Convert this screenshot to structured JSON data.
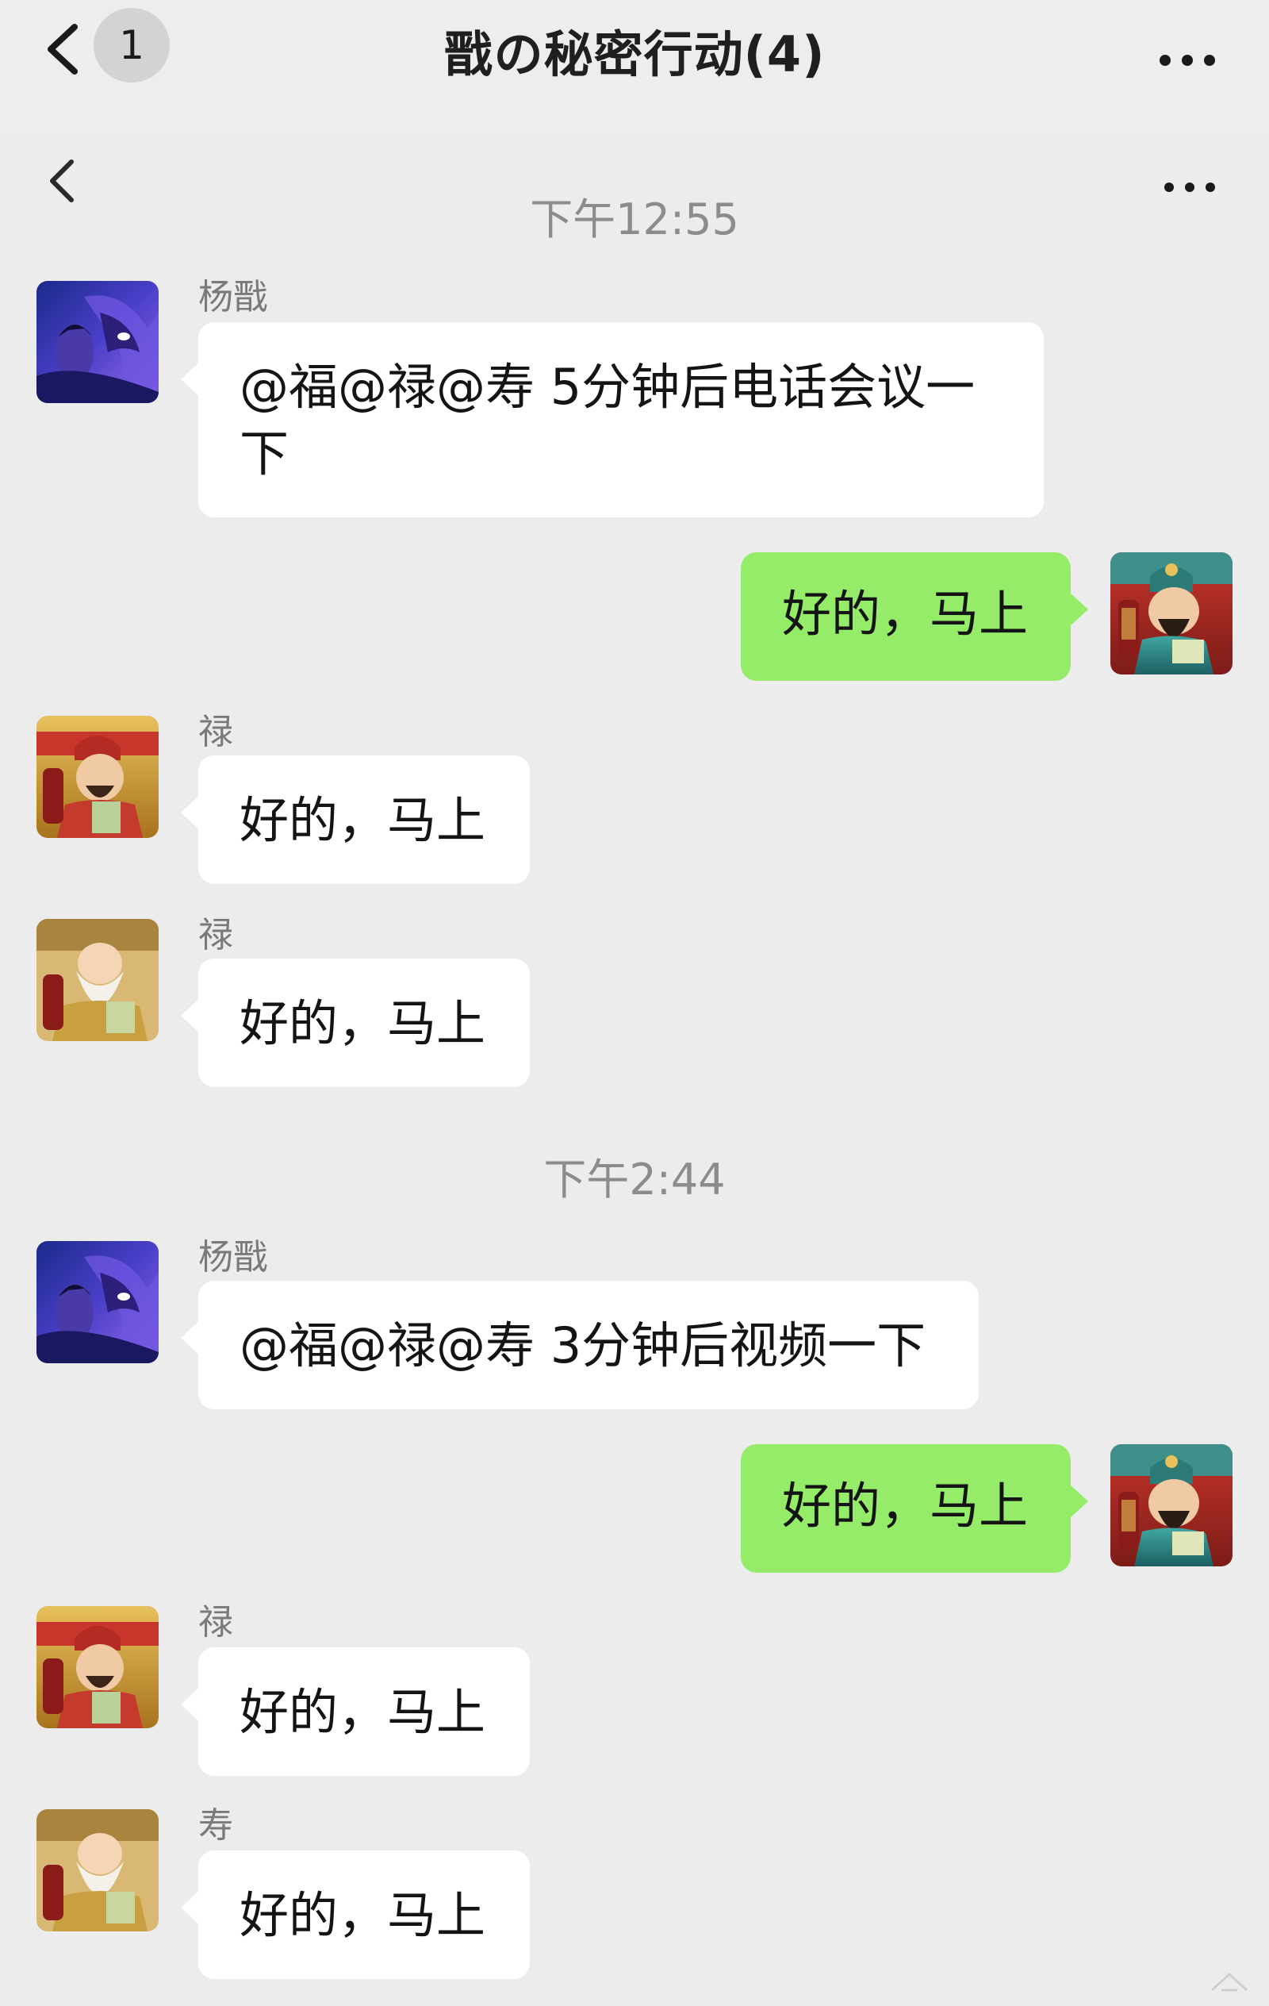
{
  "header": {
    "title": "戬の秘密行动(4)",
    "unread_count": "1"
  },
  "colors": {
    "background": "#ececec",
    "incoming_bubble": "#ffffff",
    "outgoing_bubble": "#95ec69",
    "timestamp_text": "#8c8c8c",
    "sender_text": "#7a7a7a"
  },
  "icons": {
    "back": "chevron-left-icon",
    "more": "more-horizontal-icon"
  },
  "conversation": {
    "blocks": [
      {
        "time": "下午12:55",
        "messages": [
          {
            "direction": "in",
            "sender": "杨戬",
            "avatar": "yangjian-avatar",
            "text_line1": "@福@禄@寿 5分钟后电话会议一",
            "text_line2": "下"
          },
          {
            "direction": "out",
            "avatar": "fu-avatar",
            "text": "好的，马上"
          },
          {
            "direction": "in",
            "sender": "禄",
            "avatar": "lu-avatar",
            "text": "好的，马上"
          },
          {
            "direction": "in",
            "sender": "禄",
            "avatar": "shou-avatar",
            "text": "好的，马上"
          }
        ]
      },
      {
        "time": "下午2:44",
        "messages": [
          {
            "direction": "in",
            "sender": "杨戬",
            "avatar": "yangjian-avatar",
            "text": "@福@禄@寿 3分钟后视频一下"
          },
          {
            "direction": "out",
            "avatar": "fu-avatar",
            "text": "好的，马上"
          },
          {
            "direction": "in",
            "sender": "禄",
            "avatar": "lu-avatar",
            "text": "好的，马上"
          },
          {
            "direction": "in",
            "sender": "寿",
            "avatar": "shou-avatar",
            "text": "好的，马上"
          }
        ]
      }
    ]
  }
}
